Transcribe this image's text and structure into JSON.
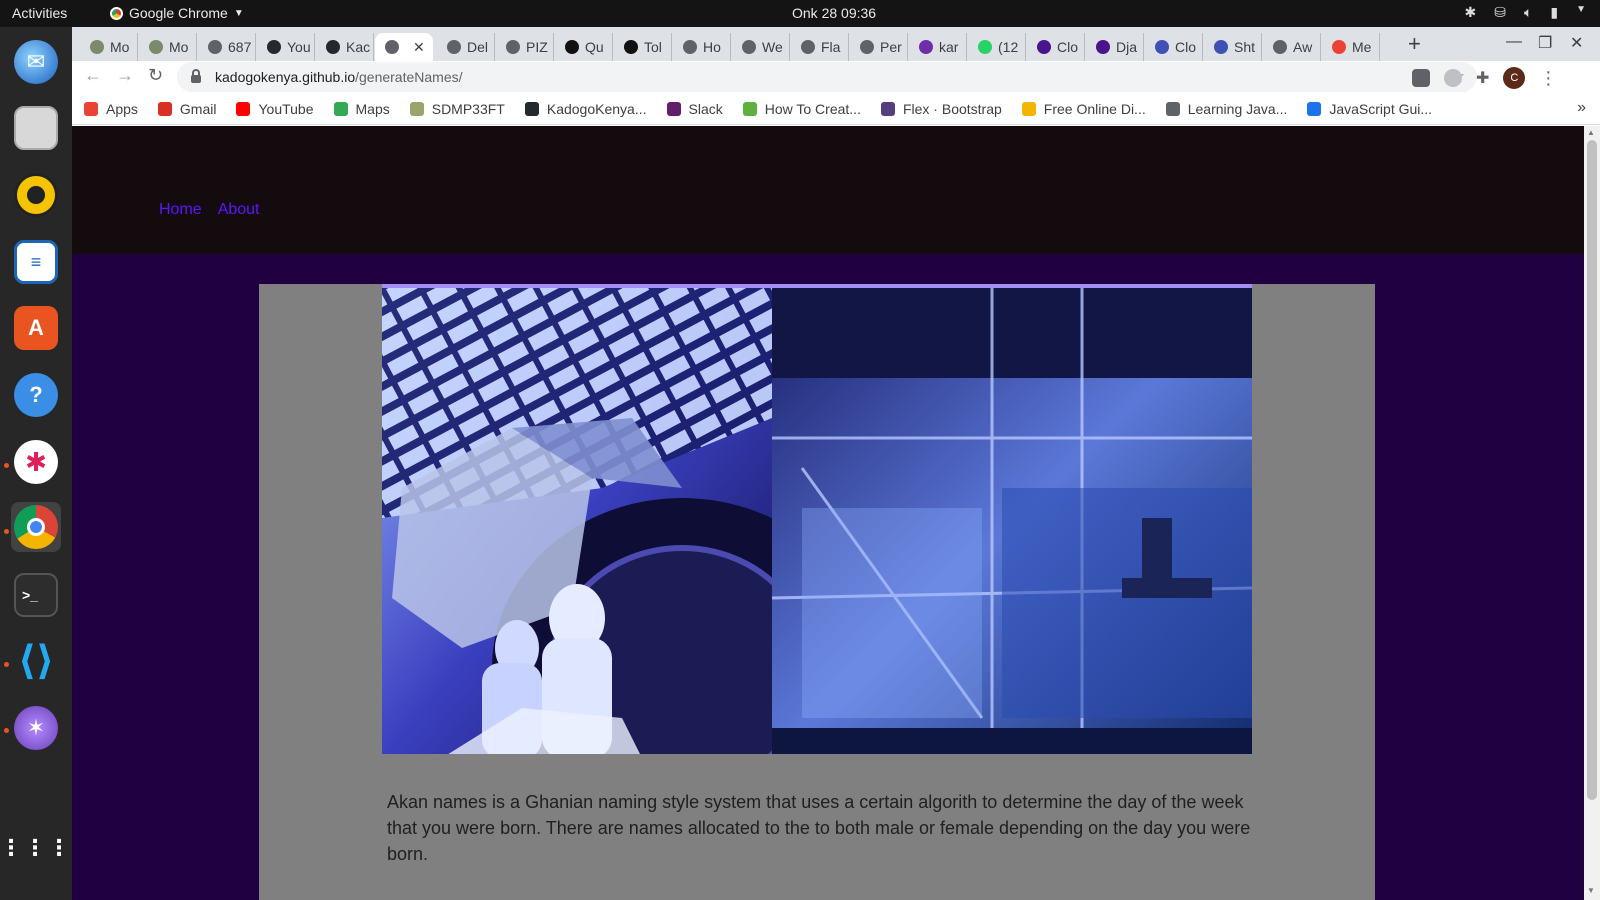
{
  "system": {
    "activities": "Activities",
    "app_name": "Google Chrome",
    "clock": "Onk 28  09:36"
  },
  "tabs": [
    {
      "label": "Mo",
      "color": "#7b8a6b"
    },
    {
      "label": "Mo",
      "color": "#7b8a6b"
    },
    {
      "label": "687",
      "color": "#5f6368"
    },
    {
      "label": "You",
      "color": "#24292e"
    },
    {
      "label": "Kac",
      "color": "#24292e"
    },
    {
      "label": "",
      "color": "#5f6368",
      "active": true
    },
    {
      "label": "Del",
      "color": "#5f6368"
    },
    {
      "label": "PIZ",
      "color": "#5f6368"
    },
    {
      "label": "Qu",
      "color": "#111111"
    },
    {
      "label": "Tol",
      "color": "#111111"
    },
    {
      "label": "Ho",
      "color": "#5f6368"
    },
    {
      "label": "We",
      "color": "#5f6368"
    },
    {
      "label": "Fla",
      "color": "#5f6368"
    },
    {
      "label": "Per",
      "color": "#5f6368"
    },
    {
      "label": "kar",
      "color": "#6f2da8"
    },
    {
      "label": "(12",
      "color": "#25d366"
    },
    {
      "label": "Clo",
      "color": "#4a148c"
    },
    {
      "label": "Dja",
      "color": "#4a148c"
    },
    {
      "label": "Clo",
      "color": "#3f51b5"
    },
    {
      "label": "Sht",
      "color": "#3f51b5"
    },
    {
      "label": "Aw",
      "color": "#5f6368"
    },
    {
      "label": "Me",
      "color": "#ea4335"
    }
  ],
  "toolbar": {
    "url_host": "kadogokenya.github.io",
    "url_path": "/generateNames/",
    "avatar": "C"
  },
  "bookmarks": [
    {
      "label": "Apps",
      "color": "#ea4335"
    },
    {
      "label": "Gmail",
      "color": "#d93025"
    },
    {
      "label": "YouTube",
      "color": "#ff0000"
    },
    {
      "label": "Maps",
      "color": "#34a853"
    },
    {
      "label": "SDMP33FT",
      "color": "#9aa56b"
    },
    {
      "label": "KadogoKenya...",
      "color": "#24292e"
    },
    {
      "label": "Slack",
      "color": "#611f69"
    },
    {
      "label": "How To Creat...",
      "color": "#5fb13f"
    },
    {
      "label": "Flex · Bootstrap",
      "color": "#563d7c"
    },
    {
      "label": "Free Online Di...",
      "color": "#f4b400"
    },
    {
      "label": "Learning Java...",
      "color": "#5f6368"
    },
    {
      "label": "JavaScript Gui...",
      "color": "#1a73e8"
    }
  ],
  "site": {
    "nav": {
      "home": "Home",
      "about": "About"
    },
    "description": "Akan names is a Ghanian naming style system that uses a certain algorith to determine the day of the week that you were born. There are names allocated to the to both male or female depending on the day you were born."
  },
  "colors": {
    "page_bg": "#200040",
    "header_bg": "#140b0e",
    "link": "#5b16ff",
    "panel": "#808080"
  },
  "dock_icons": [
    "thunderbird-icon",
    "files-icon",
    "rhythmbox-icon",
    "writer-icon",
    "software-icon",
    "help-icon",
    "slack-icon",
    "chrome-icon",
    "terminal-icon",
    "vscode-icon",
    "network-icon",
    "show-apps-icon"
  ]
}
